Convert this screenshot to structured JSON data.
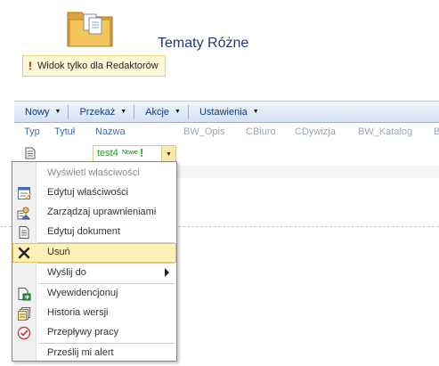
{
  "page": {
    "title": "Tematy Różne"
  },
  "notice": {
    "text": "Widok tylko dla Redaktorów",
    "icon": "exclamation-icon"
  },
  "toolbar": {
    "items": [
      {
        "label": "Nowy",
        "icon": "caret-down-icon"
      },
      {
        "label": "Przekaż",
        "icon": "caret-down-icon"
      },
      {
        "label": "Akcje",
        "icon": "caret-down-icon"
      },
      {
        "label": "Ustawienia",
        "icon": "caret-down-icon"
      }
    ]
  },
  "columns": [
    "Typ",
    "Tytuł",
    "Nazwa",
    "BW_Opis",
    "CBiuro",
    "CDywizja",
    "BW_Katalog",
    "B"
  ],
  "row": {
    "type_icon": "document-icon",
    "name": "test4",
    "new_badge": "Nowe",
    "new_icon": "new-exclamation-icon"
  },
  "context_menu": {
    "items": [
      {
        "label": "Wyświetl właściwości",
        "icon": "",
        "state": "disabled"
      },
      {
        "label": "Edytuj właściwości",
        "icon": "edit-properties-icon",
        "state": "normal"
      },
      {
        "label": "Zarządzaj uprawnieniami",
        "icon": "manage-permissions-icon",
        "state": "normal"
      },
      {
        "label": "Edytuj dokument",
        "icon": "edit-document-icon",
        "state": "normal"
      },
      {
        "label": "Usuń",
        "icon": "delete-icon",
        "state": "highlighted"
      },
      {
        "label": "Wyślij do",
        "icon": "",
        "state": "submenu"
      },
      {
        "label": "Wyewidencjonuj",
        "icon": "check-out-icon",
        "state": "normal"
      },
      {
        "label": "Historia wersji",
        "icon": "version-history-icon",
        "state": "normal"
      },
      {
        "label": "Przepływy pracy",
        "icon": "workflows-icon",
        "state": "normal"
      },
      {
        "label": "Prześlij mi alert",
        "icon": "",
        "state": "normal"
      }
    ]
  },
  "colors": {
    "toolbar_text": "#0a3a8c",
    "column_header": "#3a6dbd",
    "title": "#1f3a78",
    "link_green": "#18a518",
    "highlight": "#fff0b8"
  }
}
